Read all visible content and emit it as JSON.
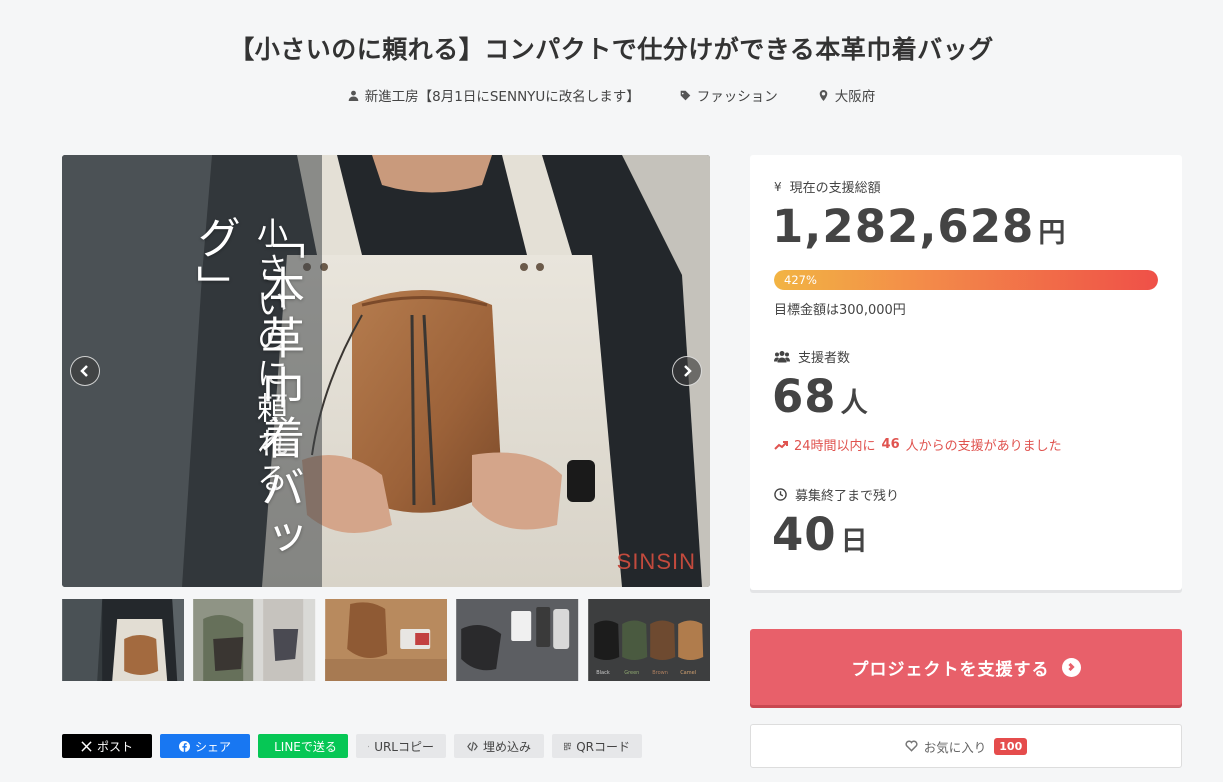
{
  "project": {
    "title": "【小さいのに頼れる】コンパクトで仕分けができる本革巾着バッグ",
    "owner": "新進工房【8月1日にSENNYUに改名します】",
    "category": "ファッション",
    "location": "大阪府"
  },
  "hero": {
    "vertical_text_1": "小さいのに頼れる",
    "vertical_text_2": "「本革巾着バッグ」",
    "brand": "SINSIN",
    "thumb_color_labels": [
      "Black",
      "Green",
      "Brown",
      "Camel"
    ]
  },
  "share": {
    "x_label": "ポスト",
    "facebook_label": "シェア",
    "line_label": "LINEで送る",
    "url_copy_label": "URLコピー",
    "embed_label": "埋め込み",
    "qr_label": "QRコード"
  },
  "stats": {
    "total_label": "現在の支援総額",
    "total_amount": "1,282,628",
    "currency_unit": "円",
    "progress_percent_label": "427%",
    "progress_fraction": 1.0,
    "goal_text": "目標金額は300,000円",
    "backers_label": "支援者数",
    "backers_count": "68",
    "backers_unit": "人",
    "trend_prefix": "24時間以内に",
    "trend_count": "46",
    "trend_suffix": "人からの支援がありました",
    "remaining_label": "募集終了まで残り",
    "remaining_days": "40",
    "days_unit": "日"
  },
  "actions": {
    "support_label": "プロジェクトを支援する",
    "favorite_label": "お気に入り",
    "favorite_count": "100"
  },
  "colors": {
    "accent": "#e8606a",
    "trend": "#e0534f",
    "badge": "#e54c4c"
  }
}
